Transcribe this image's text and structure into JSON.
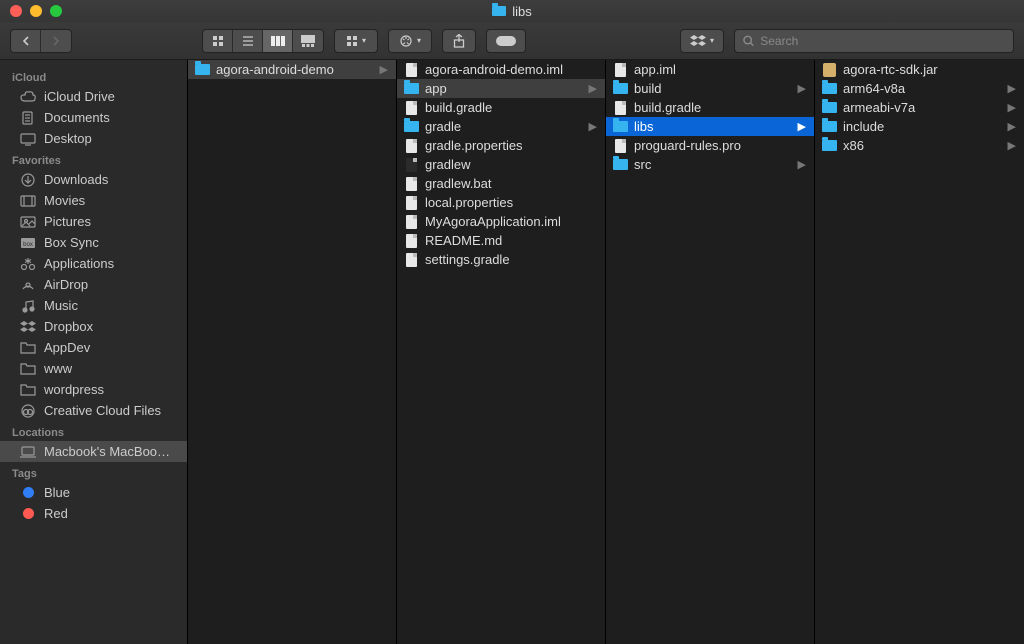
{
  "window": {
    "title": "libs"
  },
  "search": {
    "placeholder": "Search"
  },
  "sidebar": {
    "sections": [
      {
        "title": "iCloud",
        "items": [
          {
            "label": "iCloud Drive",
            "icon": "cloud"
          },
          {
            "label": "Documents",
            "icon": "doc"
          },
          {
            "label": "Desktop",
            "icon": "desktop"
          }
        ]
      },
      {
        "title": "Favorites",
        "items": [
          {
            "label": "Downloads",
            "icon": "download"
          },
          {
            "label": "Movies",
            "icon": "movie"
          },
          {
            "label": "Pictures",
            "icon": "pictures"
          },
          {
            "label": "Box Sync",
            "icon": "box"
          },
          {
            "label": "Applications",
            "icon": "apps"
          },
          {
            "label": "AirDrop",
            "icon": "airdrop"
          },
          {
            "label": "Music",
            "icon": "music"
          },
          {
            "label": "Dropbox",
            "icon": "dropbox"
          },
          {
            "label": "AppDev",
            "icon": "folder"
          },
          {
            "label": "www",
            "icon": "folder"
          },
          {
            "label": "wordpress",
            "icon": "folder"
          },
          {
            "label": "Creative Cloud Files",
            "icon": "cc"
          }
        ]
      },
      {
        "title": "Locations",
        "items": [
          {
            "label": "Macbook's MacBoo…",
            "icon": "laptop",
            "selected": true
          }
        ]
      },
      {
        "title": "Tags",
        "items": [
          {
            "label": "Blue",
            "icon": "tag",
            "color": "#2f7ef6"
          },
          {
            "label": "Red",
            "icon": "tag",
            "color": "#ff5a52"
          }
        ]
      }
    ]
  },
  "columns": [
    {
      "items": [
        {
          "name": "agora-android-demo",
          "type": "folder",
          "state": "path",
          "hasChildren": true
        }
      ]
    },
    {
      "items": [
        {
          "name": "agora-android-demo.iml",
          "type": "file"
        },
        {
          "name": "app",
          "type": "folder",
          "state": "path",
          "hasChildren": true
        },
        {
          "name": "build.gradle",
          "type": "file"
        },
        {
          "name": "gradle",
          "type": "folder",
          "hasChildren": true
        },
        {
          "name": "gradle.properties",
          "type": "file"
        },
        {
          "name": "gradlew",
          "type": "exec"
        },
        {
          "name": "gradlew.bat",
          "type": "file"
        },
        {
          "name": "local.properties",
          "type": "file"
        },
        {
          "name": "MyAgoraApplication.iml",
          "type": "file"
        },
        {
          "name": "README.md",
          "type": "file"
        },
        {
          "name": "settings.gradle",
          "type": "file"
        }
      ]
    },
    {
      "items": [
        {
          "name": "app.iml",
          "type": "file"
        },
        {
          "name": "build",
          "type": "folder",
          "hasChildren": true
        },
        {
          "name": "build.gradle",
          "type": "file"
        },
        {
          "name": "libs",
          "type": "folder",
          "state": "selected",
          "hasChildren": true
        },
        {
          "name": "proguard-rules.pro",
          "type": "file"
        },
        {
          "name": "src",
          "type": "folder",
          "hasChildren": true
        }
      ]
    },
    {
      "items": [
        {
          "name": "agora-rtc-sdk.jar",
          "type": "jar"
        },
        {
          "name": "arm64-v8a",
          "type": "folder",
          "hasChildren": true
        },
        {
          "name": "armeabi-v7a",
          "type": "folder",
          "hasChildren": true
        },
        {
          "name": "include",
          "type": "folder",
          "hasChildren": true
        },
        {
          "name": "x86",
          "type": "folder",
          "hasChildren": true
        }
      ]
    }
  ]
}
